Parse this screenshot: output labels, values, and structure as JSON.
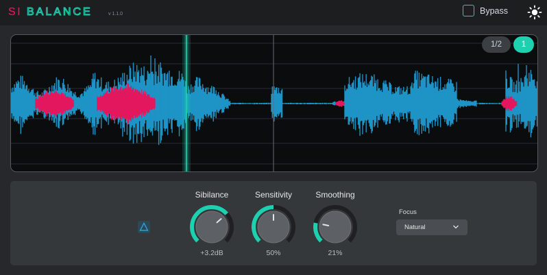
{
  "app": {
    "logo_prefix": "SI",
    "logo_suffix": "BALANCE",
    "version": "v 1.1.0"
  },
  "header": {
    "bypass_label": "Bypass",
    "theme_icon": "sun-icon"
  },
  "waveform": {
    "view_buttons": [
      "1/2",
      "1"
    ],
    "active_view": "1",
    "colors": {
      "signal": "#1d93c6",
      "sibilance": "#e3175d",
      "cursor": "#1ed0b0"
    }
  },
  "controls": {
    "delta_icon": "delta-icon",
    "knobs": [
      {
        "label": "Sibilance",
        "value": "+3.2dB",
        "level": 0.68
      },
      {
        "label": "Sensitivity",
        "value": "50%",
        "level": 0.5
      },
      {
        "label": "Smoothing",
        "value": "21%",
        "level": 0.21
      }
    ],
    "focus": {
      "label": "Focus",
      "selected": "Natural"
    }
  },
  "colors": {
    "accent": "#1ed0b0",
    "logo_red": "#e3175d",
    "background": "#26282b"
  }
}
